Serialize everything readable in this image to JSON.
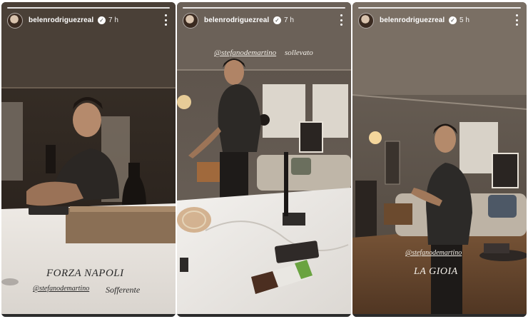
{
  "stories": [
    {
      "username": "belenrodriguezreal",
      "time": "7 h",
      "captions": {
        "headline": "FORZA NAPOLI",
        "mention": "@stefanodemartino",
        "text": "Sofferente"
      }
    },
    {
      "username": "belenrodriguezreal",
      "time": "7 h",
      "captions": {
        "mention": "@stefanodemartino",
        "text": "sollevato"
      }
    },
    {
      "username": "belenrodriguezreal",
      "time": "5 h",
      "captions": {
        "mention": "@stefanodemartino",
        "headline": "LA GIOIA"
      }
    }
  ]
}
